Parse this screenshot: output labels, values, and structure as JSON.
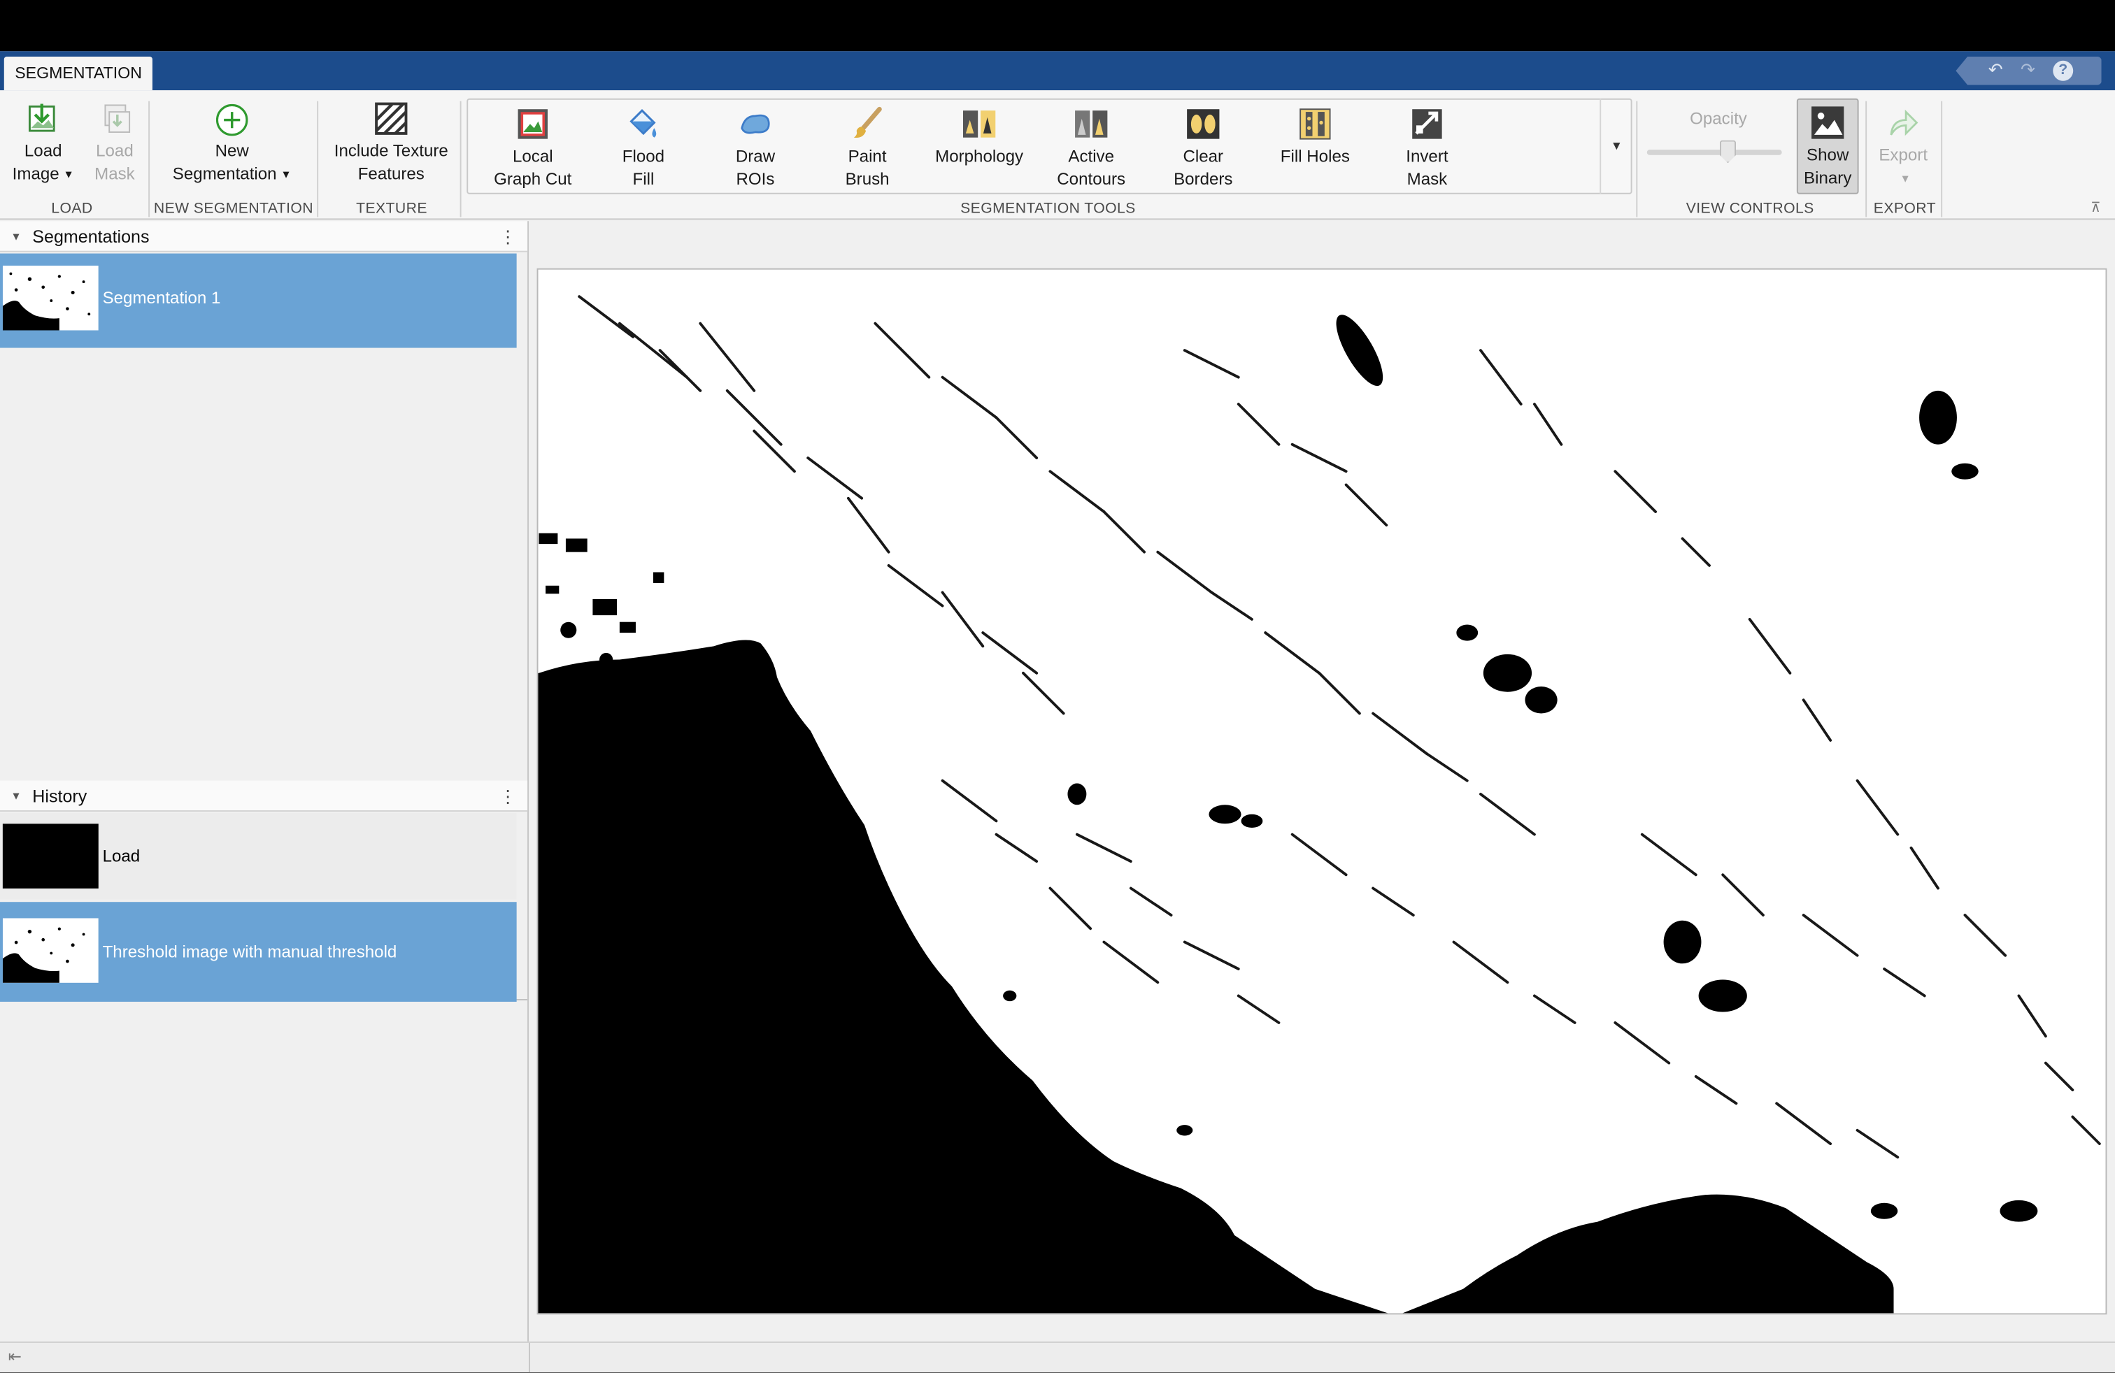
{
  "tab": "SEGMENTATION",
  "quick_access": [
    "undo-icon",
    "redo-icon",
    "help-icon"
  ],
  "ribbon": {
    "load": {
      "group_label": "LOAD",
      "load_image": [
        "Load",
        "Image"
      ],
      "load_mask": [
        "Load",
        "Mask"
      ]
    },
    "new_segmentation": {
      "group_label": "NEW SEGMENTATION",
      "button": [
        "New",
        "Segmentation"
      ]
    },
    "texture": {
      "group_label": "TEXTURE",
      "button": [
        "Include Texture",
        "Features"
      ]
    },
    "segmentation_tools": {
      "group_label": "SEGMENTATION TOOLS",
      "tools": [
        {
          "icon": "local-graph-cut-icon",
          "lines": [
            "Local",
            "Graph Cut"
          ]
        },
        {
          "icon": "flood-fill-icon",
          "lines": [
            "Flood",
            "Fill"
          ]
        },
        {
          "icon": "draw-rois-icon",
          "lines": [
            "Draw",
            "ROIs"
          ]
        },
        {
          "icon": "paint-brush-icon",
          "lines": [
            "Paint",
            "Brush"
          ]
        },
        {
          "icon": "morphology-icon",
          "lines": [
            "Morphology",
            ""
          ]
        },
        {
          "icon": "active-contours-icon",
          "lines": [
            "Active",
            "Contours"
          ]
        },
        {
          "icon": "clear-borders-icon",
          "lines": [
            "Clear",
            "Borders"
          ]
        },
        {
          "icon": "fill-holes-icon",
          "lines": [
            "Fill Holes",
            ""
          ]
        },
        {
          "icon": "invert-mask-icon",
          "lines": [
            "Invert",
            "Mask"
          ]
        }
      ]
    },
    "view_controls": {
      "group_label": "VIEW CONTROLS",
      "opacity_label": "Opacity",
      "opacity_value_fraction": 0.6,
      "show_binary": [
        "Show",
        "Binary"
      ],
      "show_binary_active": true
    },
    "export": {
      "group_label": "EXPORT",
      "button": "Export"
    }
  },
  "segmentations_panel": {
    "title": "Segmentations",
    "items": [
      {
        "label": "Segmentation 1",
        "selected": true
      }
    ]
  },
  "history_panel": {
    "title": "History",
    "items": [
      {
        "label": "Load",
        "selected": false
      },
      {
        "label": "Threshold image with manual threshold",
        "selected": true
      }
    ]
  },
  "colors": {
    "tab_strip": "#1c4c8c",
    "selection": "#6aa3d5",
    "mask_foreground": "#ffffff",
    "mask_background": "#000000"
  }
}
